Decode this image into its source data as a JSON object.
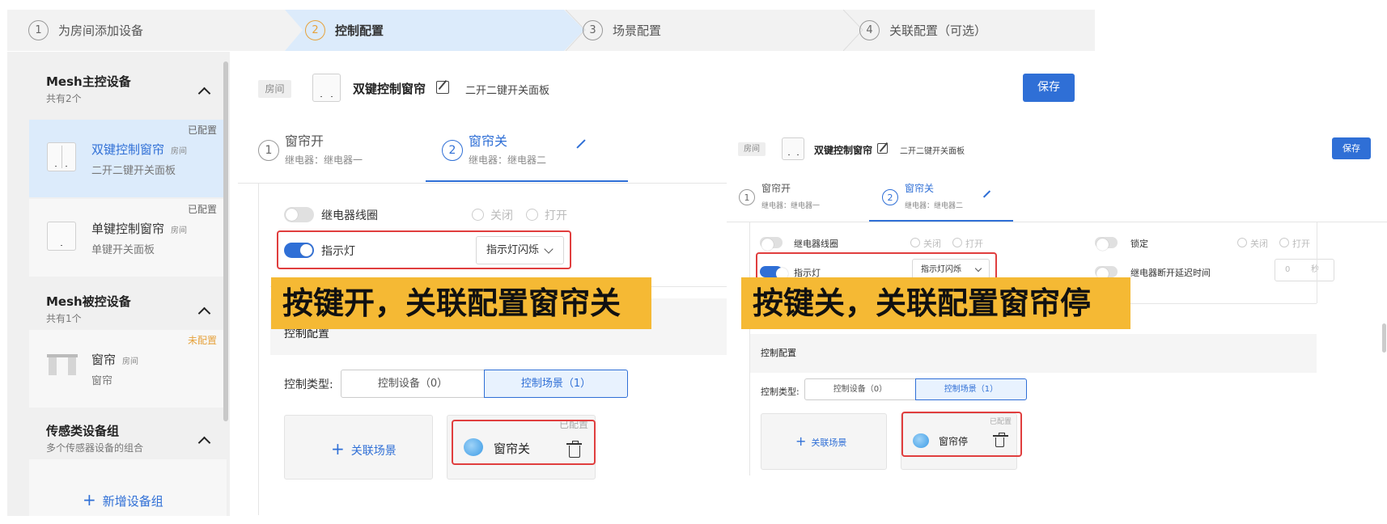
{
  "steps": [
    {
      "num": "1",
      "label": "为房间添加设备"
    },
    {
      "num": "2",
      "label": "控制配置"
    },
    {
      "num": "3",
      "label": "场景配置"
    },
    {
      "num": "4",
      "label": "关联配置（可选）"
    }
  ],
  "sidebar": {
    "group1": {
      "title": "Mesh主控设备",
      "sub": "共有2个"
    },
    "dev1": {
      "tag": "已配置",
      "name": "双键控制窗帘",
      "room": "房间",
      "type": "二开二键开关面板"
    },
    "dev2": {
      "tag": "已配置",
      "name": "单键控制窗帘",
      "room": "房间",
      "type": "单键开关面板"
    },
    "group2": {
      "title": "Mesh被控设备",
      "sub": "共有1个"
    },
    "dev3": {
      "tag": "未配置",
      "name": "窗帘",
      "room": "房间",
      "type": "窗帘"
    },
    "group3": {
      "title": "传感类设备组",
      "sub": "多个传感器设备的组合"
    },
    "add_group": "新增设备组"
  },
  "main": {
    "room": "房间",
    "device_name": "双键控制窗帘",
    "device_type": "二开二键开关面板",
    "save": "保存",
    "tab1": {
      "num": "1",
      "title": "窗帘开",
      "sub": "继电器：继电器一"
    },
    "tab2": {
      "num": "2",
      "title": "窗帘关",
      "sub": "继电器：继电器二"
    },
    "relay_coil": "继电器线圈",
    "off": "关闭",
    "on": "打开",
    "indicator": "指示灯",
    "indicator_mode": "指示灯闪烁",
    "control_config": "控制配置",
    "control_type": "控制类型:",
    "seg_device": "控制设备（0）",
    "seg_scene": "控制场景（1）",
    "add_scene": "关联场景",
    "scene_tag": "已配置",
    "scene_name": "窗帘关"
  },
  "banner1": "按键开，关联配置窗帘关",
  "banner2": "按键关，关联配置窗帘停",
  "overlay": {
    "room": "房间",
    "device_name": "双键控制窗帘",
    "device_type": "二开二键开关面板",
    "save": "保存",
    "tab1": {
      "num": "1",
      "title": "窗帘开",
      "sub": "继电器：继电器一"
    },
    "tab2": {
      "num": "2",
      "title": "窗帘关",
      "sub": "继电器：继电器二"
    },
    "relay_coil": "继电器线圈",
    "off": "关闭",
    "on": "打开",
    "lock": "锁定",
    "off2": "关闭",
    "on2": "打开",
    "indicator": "指示灯",
    "indicator_mode": "指示灯闪烁",
    "relay_delay": "继电器断开延迟时间",
    "delay_value": "0",
    "delay_unit": "秒",
    "control_config": "控制配置",
    "control_type": "控制类型:",
    "seg_device": "控制设备（0）",
    "seg_scene": "控制场景（1）",
    "add_scene": "关联场景",
    "scene_tag": "已配置",
    "scene_name": "窗帘停"
  },
  "colors": {
    "accent": "#2f6fd6",
    "warning": "#e6a23c",
    "highlight": "#f5b934",
    "red": "#e03e3e"
  }
}
